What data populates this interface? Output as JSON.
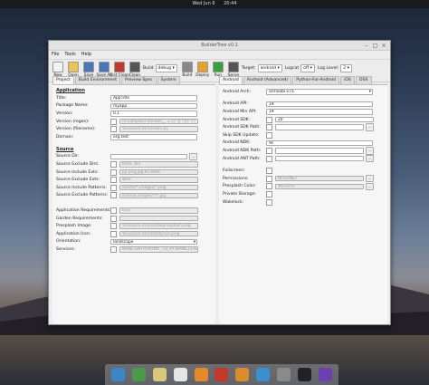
{
  "topbar": {
    "day": "Wed Jun 6",
    "time": "20:44"
  },
  "window": {
    "title": "BuilderTree v0.1"
  },
  "menu": [
    "File",
    "Tools",
    "Help"
  ],
  "toolbar": {
    "buttons": [
      {
        "label": "New",
        "icon": "new-file-icon",
        "color": "#f2f2f2"
      },
      {
        "label": "Open",
        "icon": "open-folder-icon",
        "color": "#e8c35a"
      },
      {
        "label": "Save",
        "icon": "save-icon",
        "color": "#4a76b8"
      },
      {
        "label": "Save As",
        "icon": "save-as-icon",
        "color": "#4a76b8"
      },
      {
        "label": "Dist Clean",
        "icon": "dist-clean-icon",
        "color": "#c0392b"
      },
      {
        "label": "Clean",
        "icon": "clean-icon",
        "color": "#555"
      }
    ],
    "build_label": "Build",
    "build_mode": "debug",
    "buttons2": [
      {
        "label": "Build",
        "icon": "build-icon",
        "color": "#888"
      },
      {
        "label": "Deploy",
        "icon": "deploy-icon",
        "color": "#e2a32a"
      },
      {
        "label": "Run",
        "icon": "run-icon",
        "color": "#3aa03a"
      },
      {
        "label": "Serve",
        "icon": "serve-icon",
        "color": "#555"
      }
    ],
    "target_label": "Target:",
    "target_value": "android",
    "logcat_label": "Logcat",
    "logcat_value": "off",
    "loglevel_label": "Log Level:",
    "loglevel_value": "2"
  },
  "left_tabs": [
    "Project",
    "Build Environment",
    "Preview Spec",
    "System"
  ],
  "right_tabs": [
    "Android",
    "Android (Advanced)",
    "Python-For-Android",
    "iOS",
    "OSX"
  ],
  "application": {
    "heading": "Application",
    "fields": [
      {
        "label": "Title:",
        "value": "AppTitle",
        "type": "text"
      },
      {
        "label": "Package Name:",
        "value": "myapp",
        "type": "text"
      },
      {
        "label": "Version:",
        "value": "0.1",
        "type": "text"
      },
      {
        "label": "Version (regex):",
        "value": "re.compile(r'version__ = [\\'\"](.*)[\\'\"]')",
        "type": "check-dis"
      },
      {
        "label": "Version (filename):",
        "value": "%(source.dir)s/main.py",
        "type": "check-dis"
      },
      {
        "label": "Domain:",
        "value": "org.test",
        "type": "text"
      }
    ]
  },
  "source": {
    "heading": "Source",
    "fields": [
      {
        "label": "Source Dir:",
        "value": "",
        "type": "browse"
      },
      {
        "label": "Source Exclude Dirs:",
        "value": "tests, bin",
        "type": "check-dis"
      },
      {
        "label": "Source Include Exts:",
        "value": "py,png,jpg,kv,atlas",
        "type": "check-dis"
      },
      {
        "label": "Source Exclude Exts:",
        "value": "spec",
        "type": "check-dis"
      },
      {
        "label": "Source Include Patterns:",
        "value": "assets/*,images/*.png",
        "type": "check-dis"
      },
      {
        "label": "Source Exclude Patterns:",
        "value": "license,images/*/*.jpg",
        "type": "check-dis"
      }
    ]
  },
  "more": {
    "fields": [
      {
        "label": "Application Requirements:",
        "value": "kivy",
        "type": "check-dis"
      },
      {
        "label": "Garden Requirements:",
        "value": "",
        "type": "check-dis"
      },
      {
        "label": "Presplash Image:",
        "value": "%(source.dir)s/data/presplash.png",
        "type": "check-dis"
      },
      {
        "label": "Application Icon:",
        "value": "%(source.dir)s/data/icon.png",
        "type": "check-dis"
      },
      {
        "label": "Orientation:",
        "value": "landscape",
        "type": "select"
      },
      {
        "label": "Services:",
        "value": "NAME:ENTRYPOINT_TO_PY,NAME2:ENTRYPOINT2_TO_PY",
        "type": "check-dis"
      }
    ]
  },
  "android": {
    "fields": [
      {
        "label": "Android Arch:",
        "value": "armeabi-v7a",
        "type": "select"
      },
      {
        "label": "",
        "value": "",
        "type": "spacer"
      },
      {
        "label": "Android API:",
        "value": "19",
        "type": "text"
      },
      {
        "label": "Android Min API:",
        "value": "19",
        "type": "text"
      },
      {
        "label": "Android SDK:",
        "value": "20",
        "type": "check-text"
      },
      {
        "label": "Android SDK Path:",
        "value": "",
        "type": "check-browse"
      },
      {
        "label": "Skip SDK Update:",
        "value": "",
        "type": "check"
      },
      {
        "label": "Android NDK:",
        "value": "9c",
        "type": "text"
      },
      {
        "label": "Android NDK Path:",
        "value": "",
        "type": "check-browse"
      },
      {
        "label": "Android ANT Path:",
        "value": "",
        "type": "check-browse"
      },
      {
        "label": "",
        "value": "",
        "type": "spacer"
      },
      {
        "label": "Fullscreen:",
        "value": "",
        "type": "check"
      },
      {
        "label": "Permissions:",
        "value": "INTERNET",
        "type": "check-dis-browse"
      },
      {
        "label": "Presplash Color:",
        "value": "#FFFFFF",
        "type": "check-dis-browse"
      },
      {
        "label": "Private Storage:",
        "value": "",
        "type": "check"
      },
      {
        "label": "Wakelock:",
        "value": "",
        "type": "check"
      }
    ]
  },
  "dock": [
    {
      "icon": "files-icon",
      "color": "#3b86c7"
    },
    {
      "icon": "browser-icon",
      "color": "#4a9a4a"
    },
    {
      "icon": "mail-icon",
      "color": "#d9c77c"
    },
    {
      "icon": "calendar-icon",
      "color": "#e6e6e6"
    },
    {
      "icon": "music-icon",
      "color": "#e48a2a"
    },
    {
      "icon": "video-icon",
      "color": "#c0392b"
    },
    {
      "icon": "photos-icon",
      "color": "#d98c2e"
    },
    {
      "icon": "software-icon",
      "color": "#3a8fd0"
    },
    {
      "icon": "settings-icon",
      "color": "#8a8a8a"
    },
    {
      "icon": "terminal-icon",
      "color": "#222"
    },
    {
      "icon": "app-icon",
      "color": "#6d3fb0"
    }
  ]
}
